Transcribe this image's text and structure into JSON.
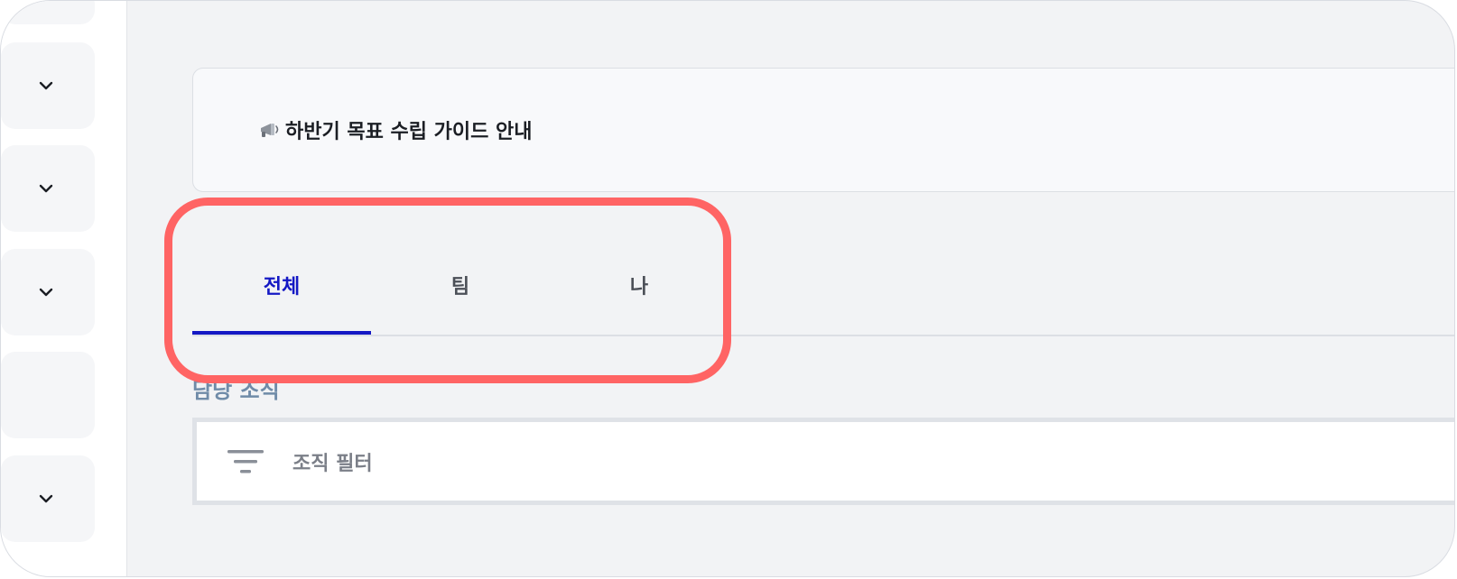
{
  "notice": {
    "icon": "megaphone-icon",
    "title": "하반기 목표 수립 가이드 안내"
  },
  "tabs": [
    {
      "label": "전체",
      "active": true
    },
    {
      "label": "팀",
      "active": false
    },
    {
      "label": "나",
      "active": false
    }
  ],
  "filter_section": {
    "label": "담당 조직",
    "placeholder": "조직 필터",
    "icon": "filter-icon"
  },
  "sidebar": {
    "items": [
      {
        "icon": "chevron-down-icon"
      },
      {
        "icon": "chevron-down-icon"
      },
      {
        "icon": "chevron-down-icon"
      },
      {
        "icon": "none"
      },
      {
        "icon": "chevron-down-icon"
      }
    ]
  },
  "colors": {
    "active_tab": "#1418c4",
    "highlight_outline": "#ff6464",
    "section_label": "#6f8ba8"
  }
}
